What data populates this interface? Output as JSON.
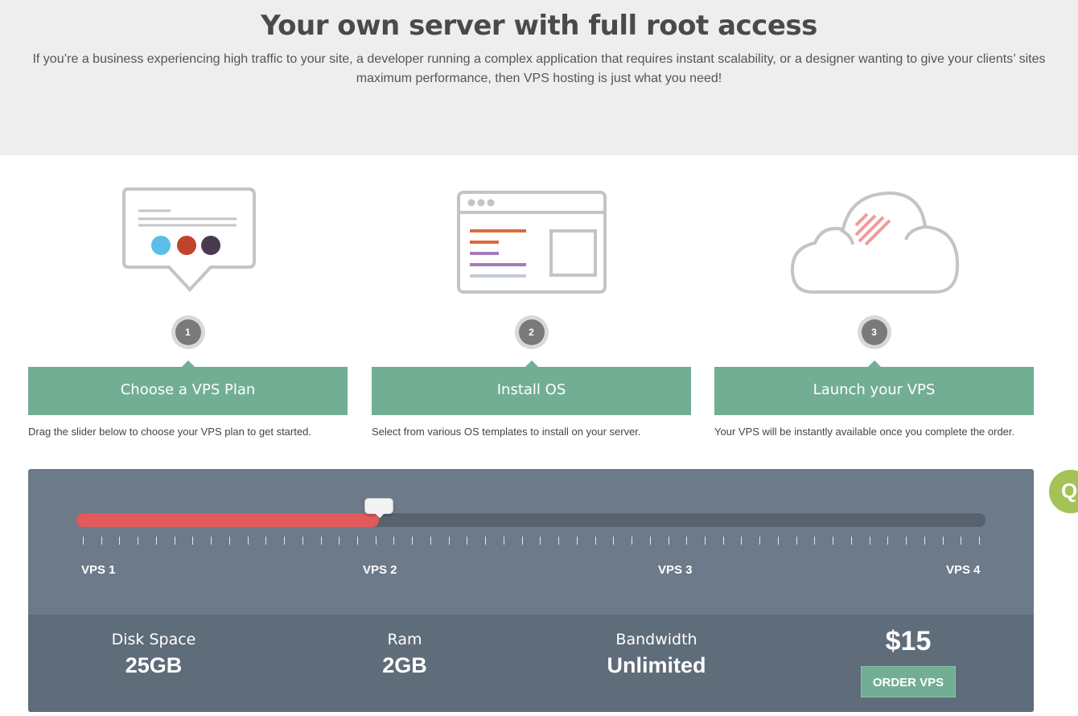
{
  "hero": {
    "title": "Your own server with full root access",
    "text": "If you’re a business experiencing high traffic to your site, a developer running a complex application that requires instant scalability, or a designer wanting to give your clients’ sites maximum performance, then VPS hosting is just what you need!"
  },
  "steps": [
    {
      "number": "1",
      "title": "Choose a VPS Plan",
      "desc": "Drag the slider below to choose your VPS plan to get started.",
      "icon": "speech-bubble-icon"
    },
    {
      "number": "2",
      "title": "Install OS",
      "desc": "Select from various OS templates to install on your server.",
      "icon": "browser-window-icon"
    },
    {
      "number": "3",
      "title": "Launch your VPS",
      "desc": "Your VPS will be instantly available once you complete the order.",
      "icon": "cloud-icon"
    }
  ],
  "slider": {
    "labels": [
      "VPS 1",
      "VPS 2",
      "VPS 3",
      "VPS 4"
    ],
    "value_fraction": 0.333,
    "fill_color": "#e25a5a"
  },
  "plan": {
    "disk_label": "Disk Space",
    "disk_value": "25GB",
    "ram_label": "Ram",
    "ram_value": "2GB",
    "bandwidth_label": "Bandwidth",
    "bandwidth_value": "Unlimited",
    "price": "$15",
    "order_label": "ORDER VPS"
  },
  "colors": {
    "accent_green": "#72ae94",
    "panel": "#6d7a89",
    "chat": "#a4c257"
  },
  "chat": {
    "icon": "chat-icon",
    "glyph": "Q"
  }
}
